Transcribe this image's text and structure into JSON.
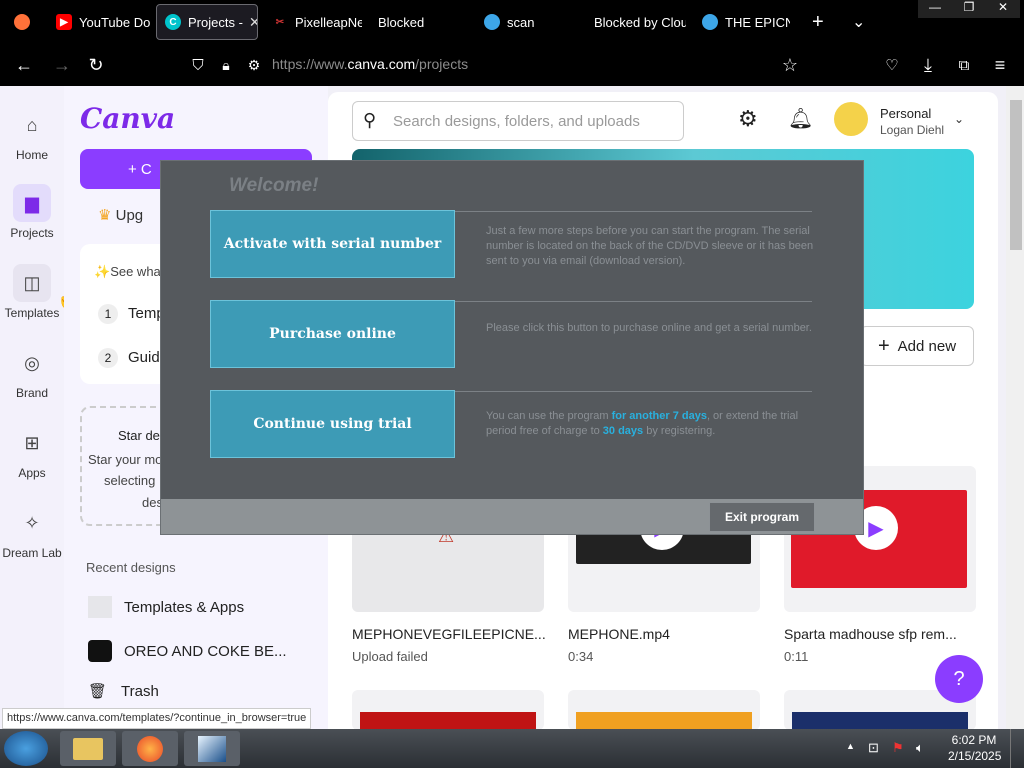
{
  "browser": {
    "tabs": [
      {
        "label": "YouTube Do",
        "icon": "youtube-icon",
        "color": "#ff0000"
      },
      {
        "label": "Projects -",
        "icon": "canva-icon",
        "color": "#00c4cc",
        "active": true
      },
      {
        "label": "PixelleapNe",
        "icon": "pixelleap-icon",
        "color": "#b00"
      },
      {
        "label": "Blocked",
        "icon": "",
        "color": ""
      },
      {
        "label": "scan",
        "icon": "edge-icon",
        "color": "#3da6e8"
      },
      {
        "label": "Blocked by Clou",
        "icon": "",
        "color": ""
      },
      {
        "label": "THE EPICNE",
        "icon": "edge-icon",
        "color": "#3da6e8"
      }
    ],
    "new_tab": "+",
    "tab_list": "⌄",
    "url_prefix": "https://www.",
    "url_host": "canva.com",
    "url_path": "/projects",
    "window_controls": {
      "minimize": "—",
      "restore": "❐",
      "close": "✕"
    }
  },
  "rail": [
    {
      "label": "Home",
      "icon": "home-icon"
    },
    {
      "label": "Projects",
      "icon": "folder-icon"
    },
    {
      "label": "Templates",
      "icon": "templates-icon"
    },
    {
      "label": "Brand",
      "icon": "brand-icon"
    },
    {
      "label": "Apps",
      "icon": "apps-icon"
    },
    {
      "label": "Dream Lab",
      "icon": "dream-lab-icon"
    }
  ],
  "sidebar": {
    "logo": "Canva",
    "create_label": "+ C",
    "upgrade_label": "Upg",
    "see_what": "See wha",
    "steps": [
      {
        "num": "1",
        "label": "Templ"
      },
      {
        "num": "2",
        "label": "Guid"
      }
    ],
    "star_title": "Star de",
    "star_desc_1": "Star your mo",
    "star_desc_2": "selecting",
    "star_desc_3": "des",
    "recent_title": "Recent designs",
    "recent": [
      {
        "label": "Templates & Apps"
      },
      {
        "label": "OREO AND COKE BE..."
      }
    ],
    "trash": "Trash"
  },
  "main": {
    "search_placeholder": "Search designs, folders, and uploads",
    "account_type": "Personal",
    "account_name": "Logan Diehl",
    "add_new": "Add new",
    "files": [
      {
        "name": "MEPHONEVEGFILEEPICNE...",
        "sub": "Upload failed"
      },
      {
        "name": "MEPHONE.mp4",
        "sub": "0:34"
      },
      {
        "name": "Sparta madhouse sfp rem...",
        "sub": "0:11"
      }
    ],
    "help": "?"
  },
  "dialog": {
    "title": "Welcome!",
    "options": [
      {
        "button": "Activate with serial number",
        "text": "Just a few more steps before you can start the program. The serial number is located on the back of the CD/DVD sleeve or it has been sent to you via email (download version)."
      },
      {
        "button": "Purchase online",
        "text": "Please click this button to purchase online and get a serial number."
      },
      {
        "button": "Continue using trial",
        "text_a": "You can use the program ",
        "text_b": "for another 7 days",
        "text_c": ", or extend the trial period free of charge to ",
        "text_d": "30 days",
        "text_e": " by registering."
      }
    ],
    "exit": "Exit program"
  },
  "status_url": "https://www.canva.com/templates/?continue_in_browser=true",
  "taskbar": {
    "time": "6:02 PM",
    "date": "2/15/2025"
  }
}
